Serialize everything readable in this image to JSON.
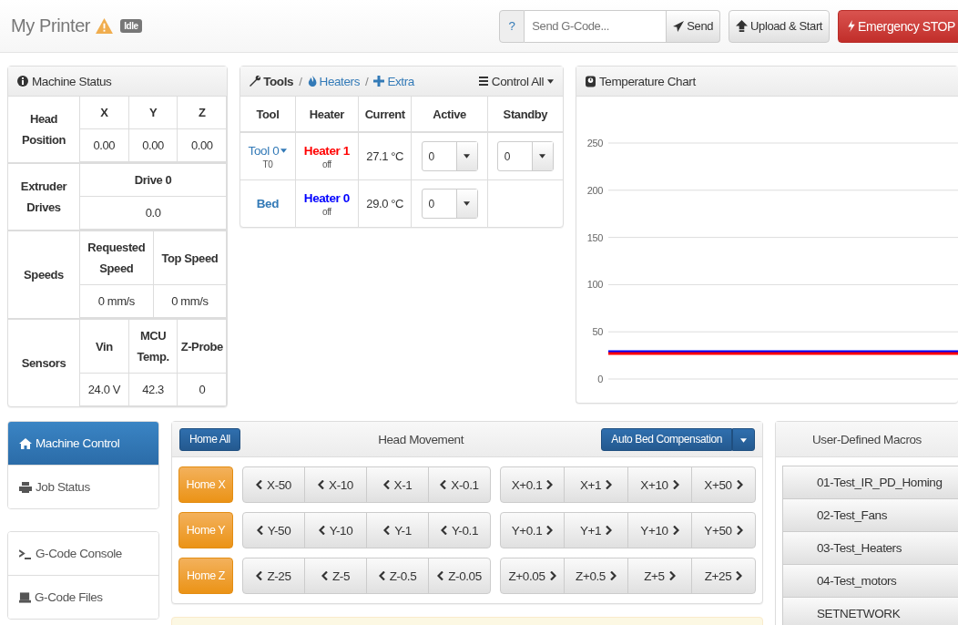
{
  "header": {
    "title": "My Printer",
    "status_badge": "Idle",
    "help": "?",
    "gcode_field": {
      "placeholder": "Send G-Code..."
    },
    "send": "Send",
    "upload": "Upload & Start",
    "emergency": "Emergency STOP"
  },
  "machine_status": {
    "title": "Machine Status",
    "sections": [
      {
        "label": "Head Position",
        "columns": [
          "X",
          "Y",
          "Z"
        ],
        "values": [
          "0.00",
          "0.00",
          "0.00"
        ]
      },
      {
        "label": "Extruder Drives",
        "columns": [
          "Drive 0"
        ],
        "values": [
          "0.0"
        ]
      },
      {
        "label": "Speeds",
        "columns": [
          "Requested Speed",
          "Top Speed"
        ],
        "values": [
          "0 mm/s",
          "0 mm/s"
        ]
      },
      {
        "label": "Sensors",
        "columns": [
          "Vin",
          "MCU Temp.",
          "Z-Probe"
        ],
        "values": [
          "24.0 V",
          "42.3",
          "0"
        ]
      }
    ]
  },
  "tools": {
    "separator": "/",
    "tabs": [
      {
        "label": "Tools",
        "selected": true
      },
      {
        "label": "Heaters",
        "selected": false
      },
      {
        "label": "Extra",
        "selected": false
      }
    ],
    "control_all": "Control All",
    "columns": [
      "Tool",
      "Heater",
      "Current",
      "Active",
      "Standby"
    ],
    "rows": [
      {
        "tool": "Tool 0",
        "tool_menu": true,
        "tool_sub": "T0",
        "heater": "Heater 1",
        "color": "#ff0000",
        "heater_state": "off",
        "current": "27.1 °C",
        "active": "0",
        "standby": "0"
      },
      {
        "tool": "Bed",
        "tool_menu": false,
        "heater": "Heater 0",
        "color": "#0000ff",
        "heater_state": "off",
        "current": "29.0 °C",
        "active": "0"
      }
    ]
  },
  "temperature_chart": {
    "title": "Temperature Chart",
    "chart_data": {
      "type": "line",
      "grid": true,
      "ylim": [
        0,
        250
      ],
      "yticks": [
        0,
        50,
        100,
        150,
        200,
        250
      ],
      "series": [
        {
          "color": "#0000ff",
          "values": [
            29,
            29,
            29,
            29,
            29,
            29,
            29,
            29,
            29,
            29,
            29,
            29
          ]
        },
        {
          "color": "#ff0000",
          "values": [
            27,
            27,
            27,
            27,
            27,
            27,
            27,
            27,
            27,
            27,
            27,
            27
          ]
        }
      ]
    }
  },
  "sidebar": {
    "groups": [
      [
        {
          "label": "Machine Control",
          "selected": true
        },
        {
          "label": "Job Status",
          "selected": false
        }
      ],
      [
        {
          "label": "G-Code Console",
          "selected": false
        },
        {
          "label": "G-Code Files",
          "selected": false
        }
      ]
    ]
  },
  "head_movement": {
    "title": "Head Movement",
    "home_all": "Home All",
    "compensation": "Auto Bed Compensation",
    "rows": [
      {
        "home": "Home X",
        "minus": [
          "X-50",
          "X-10",
          "X-1",
          "X-0.1"
        ],
        "plus": [
          "X+0.1",
          "X+1",
          "X+10",
          "X+50"
        ]
      },
      {
        "home": "Home Y",
        "minus": [
          "Y-50",
          "Y-10",
          "Y-1",
          "Y-0.1"
        ],
        "plus": [
          "Y+0.1",
          "Y+1",
          "Y+10",
          "Y+50"
        ]
      },
      {
        "home": "Home Z",
        "minus": [
          "Z-25",
          "Z-5",
          "Z-0.5",
          "Z-0.05"
        ],
        "plus": [
          "Z+0.05",
          "Z+0.5",
          "Z+5",
          "Z+25"
        ]
      }
    ]
  },
  "macros": {
    "title": "User-Defined Macros",
    "items": [
      "01-Test_IR_PD_Homing",
      "02-Test_Fans",
      "03-Test_Heaters",
      "04-Test_motors",
      "SETNETWORK"
    ]
  }
}
